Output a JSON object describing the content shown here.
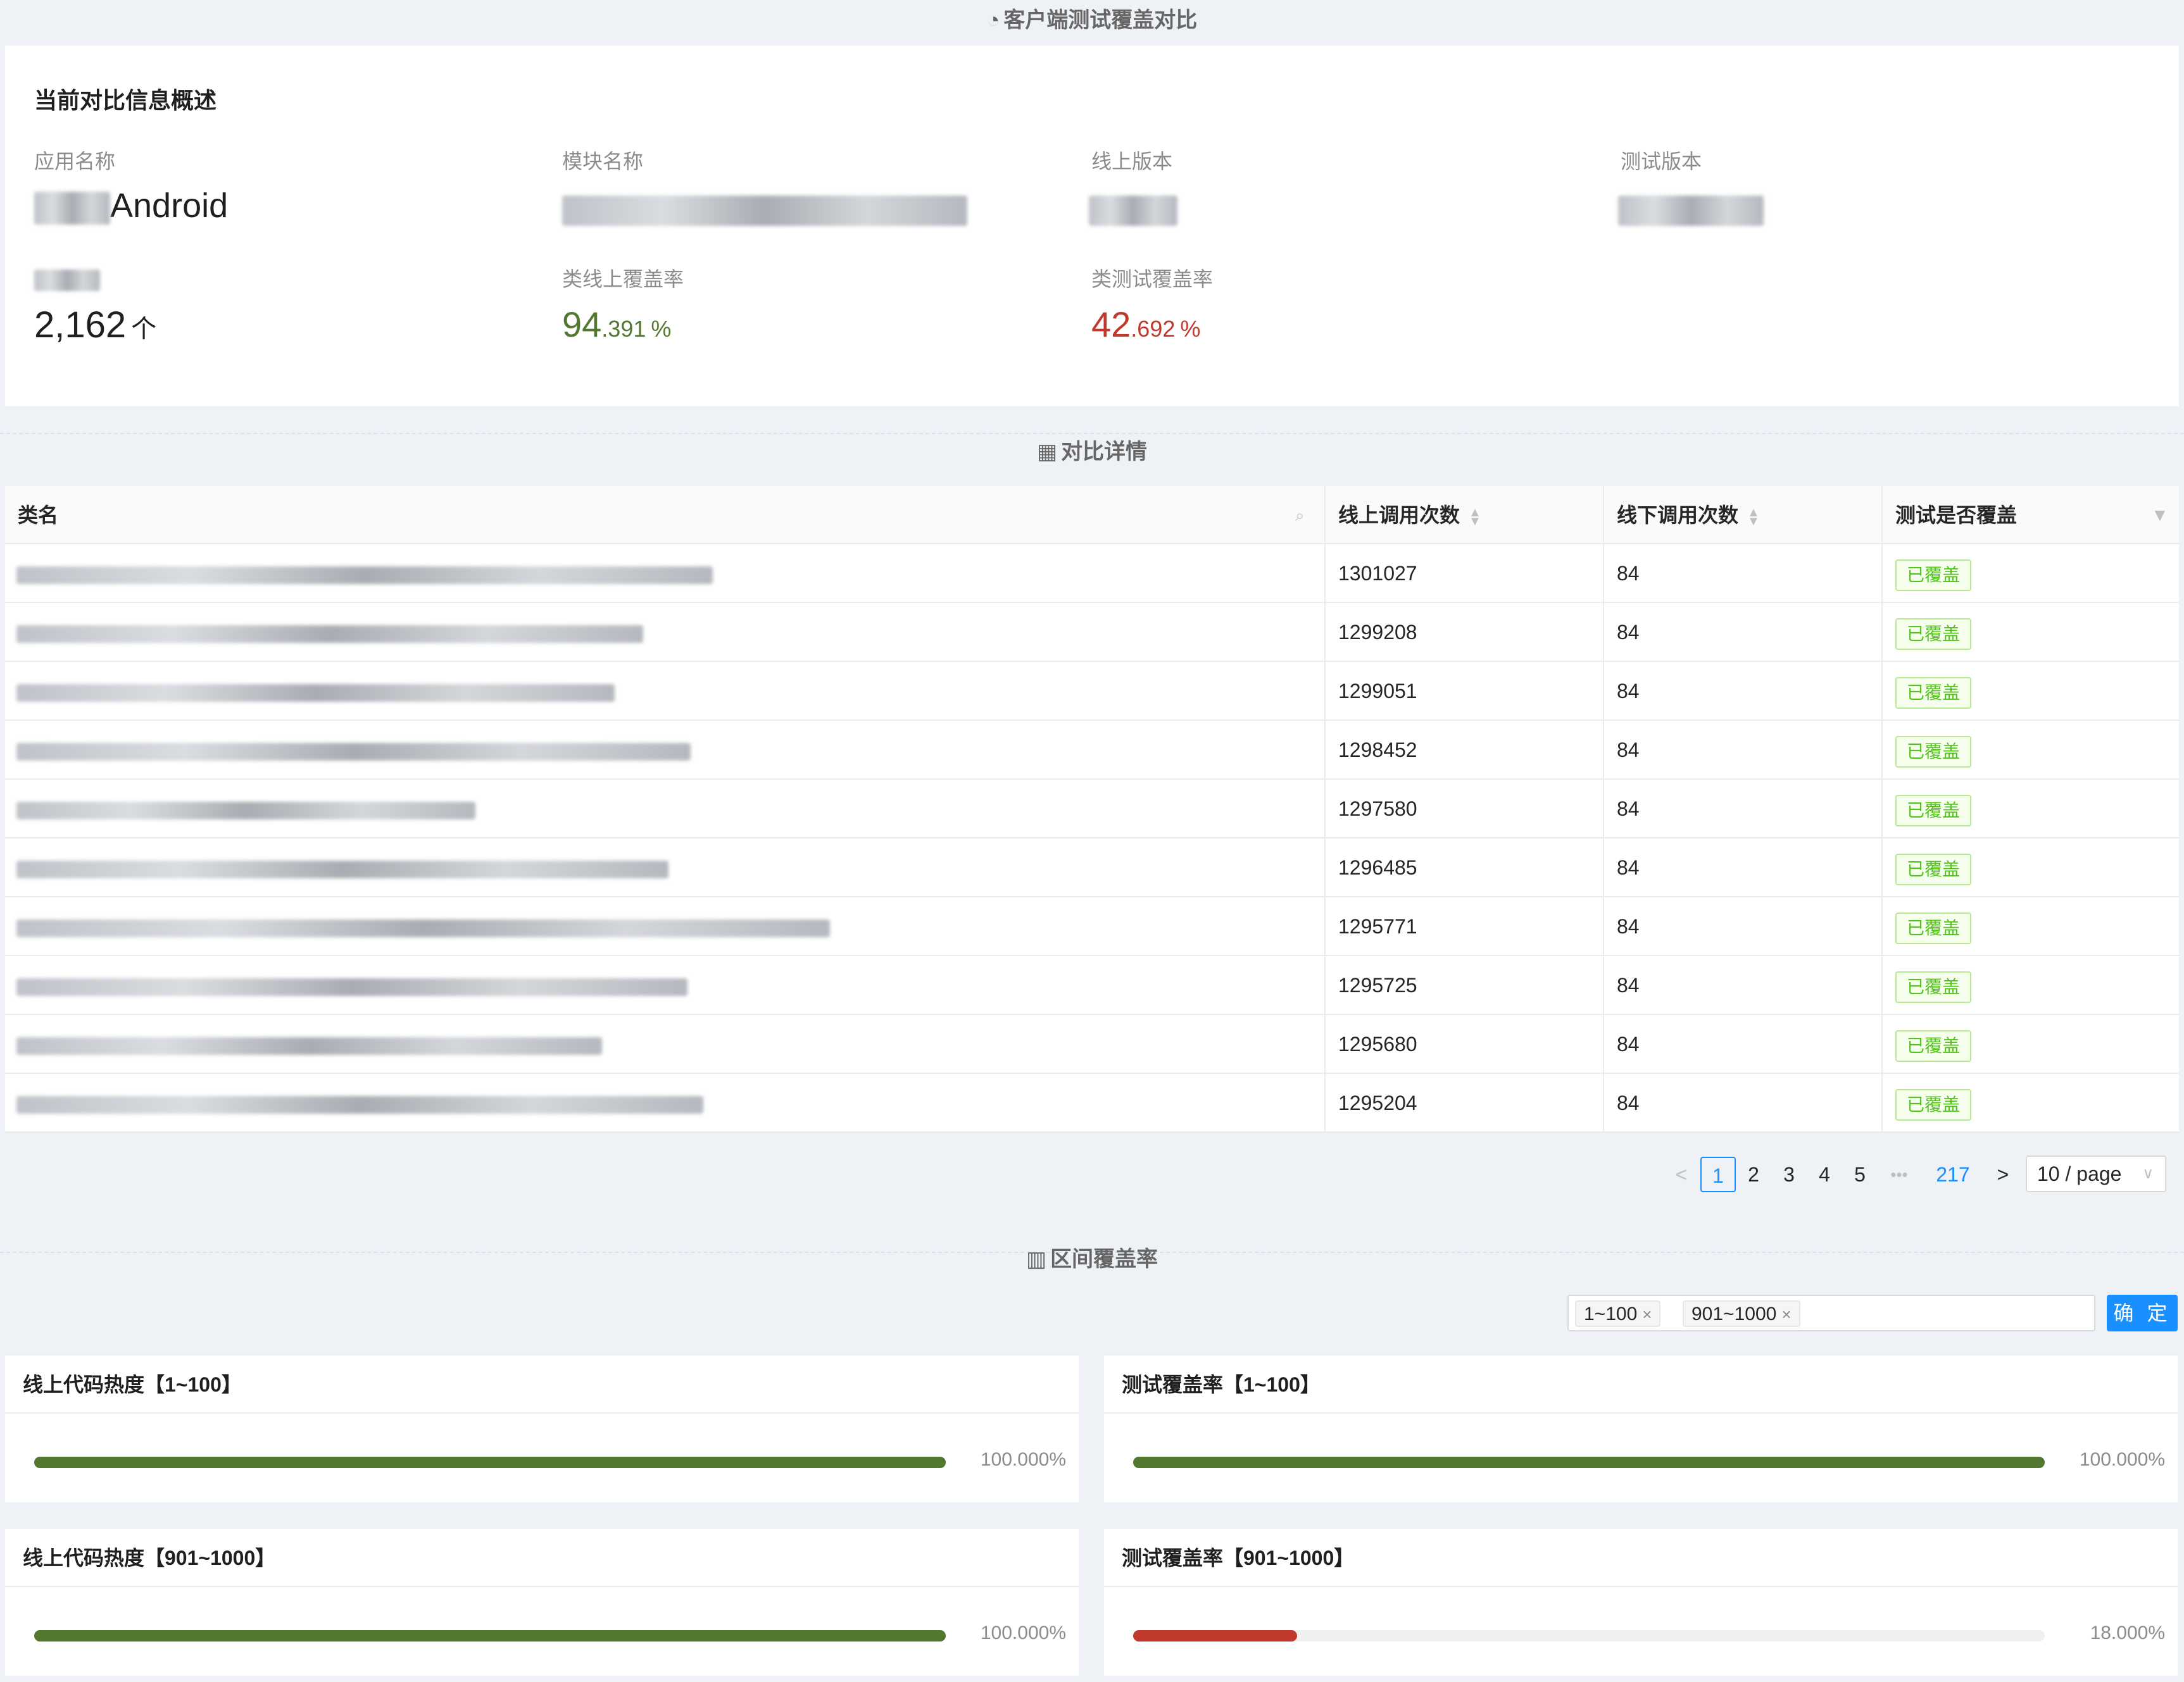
{
  "page": {
    "title": "客户端测试覆盖对比",
    "title_icon": "pie-chart-icon"
  },
  "overview": {
    "card_title": "当前对比信息概述",
    "fields": [
      {
        "label": "应用名称",
        "value": "Android"
      },
      {
        "label": "模块名称",
        "value": ""
      },
      {
        "label": "线上版本",
        "value": ""
      },
      {
        "label": "测试版本",
        "value": ""
      }
    ],
    "count": {
      "value": "2,162",
      "unit": "个"
    },
    "online_cov": {
      "label": "类线上覆盖率",
      "int": "94",
      "dec": ".391",
      "unit": "%",
      "color": "#52782f"
    },
    "test_cov": {
      "label": "类测试覆盖率",
      "int": "42",
      "dec": ".692",
      "unit": "%",
      "color": "#c0392b"
    }
  },
  "details": {
    "title": "对比详情",
    "title_icon": "table-icon",
    "columns": [
      "类名",
      "线上调用次数",
      "线下调用次数",
      "测试是否覆盖"
    ],
    "rows": [
      {
        "online": "1301027",
        "offline": "84",
        "covered": "已覆盖"
      },
      {
        "online": "1299208",
        "offline": "84",
        "covered": "已覆盖"
      },
      {
        "online": "1299051",
        "offline": "84",
        "covered": "已覆盖"
      },
      {
        "online": "1298452",
        "offline": "84",
        "covered": "已覆盖"
      },
      {
        "online": "1297580",
        "offline": "84",
        "covered": "已覆盖"
      },
      {
        "online": "1296485",
        "offline": "84",
        "covered": "已覆盖"
      },
      {
        "online": "1295771",
        "offline": "84",
        "covered": "已覆盖"
      },
      {
        "online": "1295725",
        "offline": "84",
        "covered": "已覆盖"
      },
      {
        "online": "1295680",
        "offline": "84",
        "covered": "已覆盖"
      },
      {
        "online": "1295204",
        "offline": "84",
        "covered": "已覆盖"
      }
    ]
  },
  "pagination": {
    "prev": "<",
    "pages": [
      "1",
      "2",
      "3",
      "4",
      "5"
    ],
    "ellipsis": "•••",
    "last": "217",
    "next": ">",
    "page_size": "10 / page"
  },
  "range": {
    "title": "区间覆盖率",
    "title_icon": "bar-chart-icon",
    "chips": [
      "1~100",
      "901~1000"
    ],
    "confirm": "确 定",
    "cards": [
      {
        "title": "线上代码热度【1~100】",
        "pct": "100.000%",
        "value": 1.0,
        "color": "#52782f"
      },
      {
        "title": "测试覆盖率【1~100】",
        "pct": "100.000%",
        "value": 1.0,
        "color": "#52782f"
      },
      {
        "title": "线上代码热度【901~1000】",
        "pct": "100.000%",
        "value": 1.0,
        "color": "#52782f"
      },
      {
        "title": "测试覆盖率【901~1000】",
        "pct": "18.000%",
        "value": 0.18,
        "color": "#c0392b"
      }
    ]
  }
}
